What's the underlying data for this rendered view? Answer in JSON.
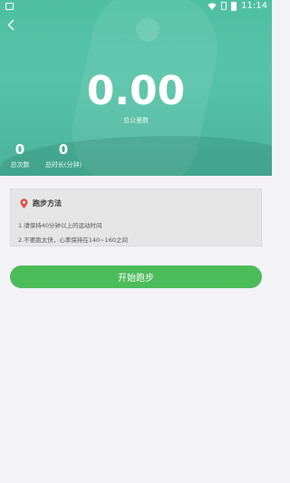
{
  "status_bar": {
    "time": "11:14"
  },
  "summary": {
    "total_distance": "0.00",
    "total_distance_label": "总公里数",
    "total_count": "0",
    "total_count_label": "总次数",
    "total_duration": "0",
    "total_duration_label": "总时长(分钟)"
  },
  "method": {
    "title": "跑步方法",
    "items": [
      "1.请保持40分钟以上的运动时间",
      "2.不要跑太快，心率保持在140~160之间"
    ]
  },
  "actions": {
    "start_label": "开始跑步"
  },
  "colors": {
    "hero_background": "#4fbfa2",
    "start_button": "#4cbb59",
    "pin_icon": "#e04b4b"
  },
  "icons": {
    "back": "chevron-left-icon",
    "method": "location-pin-icon",
    "status": [
      "image-icon",
      "wifi-icon",
      "sim-icon",
      "battery-icon"
    ]
  }
}
